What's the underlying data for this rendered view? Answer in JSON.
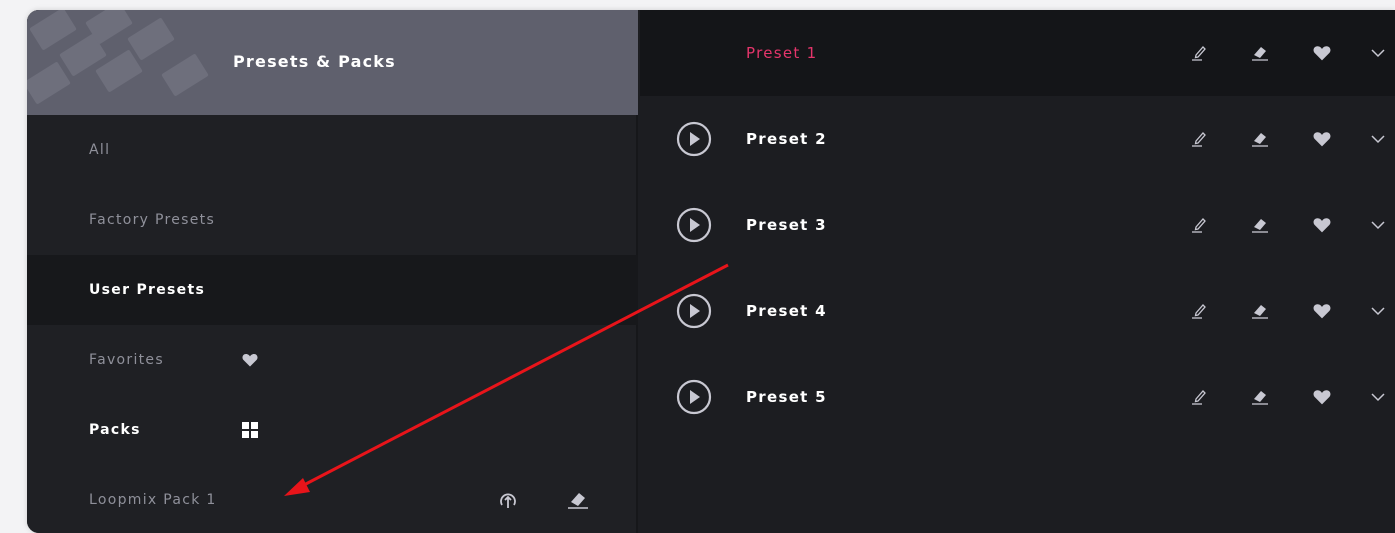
{
  "sidebar": {
    "title": "Presets & Packs",
    "items": [
      {
        "label": "All"
      },
      {
        "label": "Factory Presets"
      },
      {
        "label": "User Presets"
      },
      {
        "label": "Favorites"
      },
      {
        "label": "Packs"
      },
      {
        "label": "Loopmix Pack 1"
      }
    ]
  },
  "presets": [
    {
      "name": "Preset 1"
    },
    {
      "name": "Preset 2"
    },
    {
      "name": "Preset 3"
    },
    {
      "name": "Preset 4"
    },
    {
      "name": "Preset 5"
    }
  ],
  "colors": {
    "accent": "#e5356b",
    "annotation_arrow": "#e8141a",
    "header_bg": "#5f606d",
    "panel_bg": "#1c1d21"
  },
  "icons": {
    "play": "play-circle-icon",
    "rename": "pencil-icon",
    "delete": "eraser-icon",
    "favorite": "heart-icon",
    "expand": "chevron-down-icon",
    "packs": "grid-icon",
    "export": "upload-icon"
  }
}
